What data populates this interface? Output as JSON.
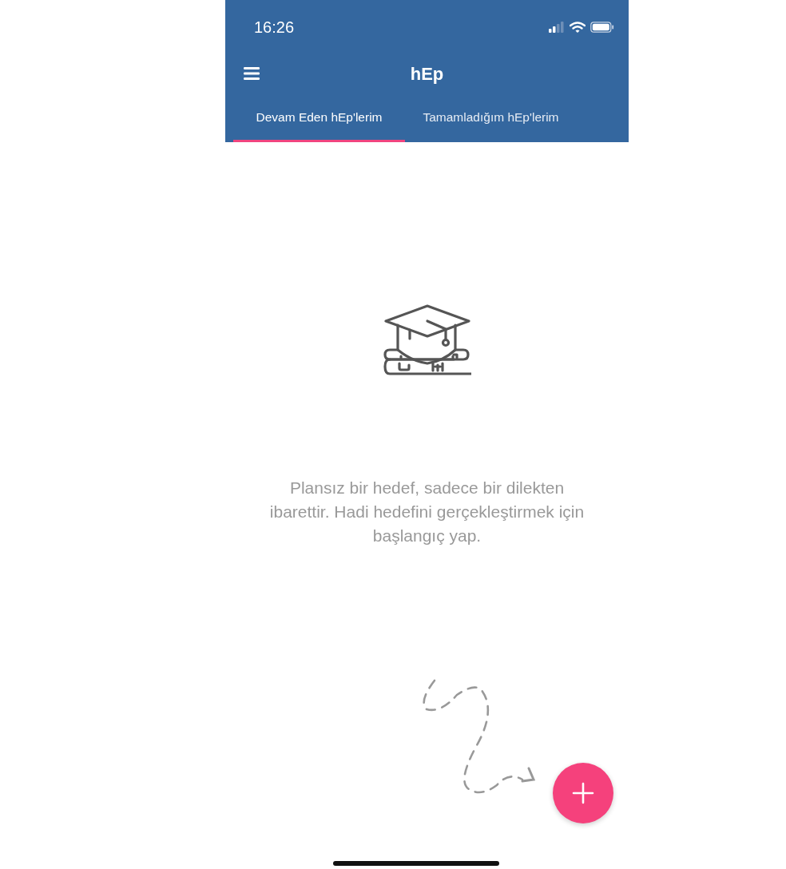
{
  "status_bar": {
    "time": "16:26"
  },
  "app_bar": {
    "title": "hEp"
  },
  "tabs": [
    {
      "label": "Devam Eden hEp'lerim",
      "selected": true
    },
    {
      "label": "Tamamladığım hEp'lerim",
      "selected": false
    }
  ],
  "empty_state": {
    "message": "Plansız bir hedef, sadece bir dilekten ibarettir. Hadi hedefini gerçekleştirmek için başlangıç yap."
  }
}
